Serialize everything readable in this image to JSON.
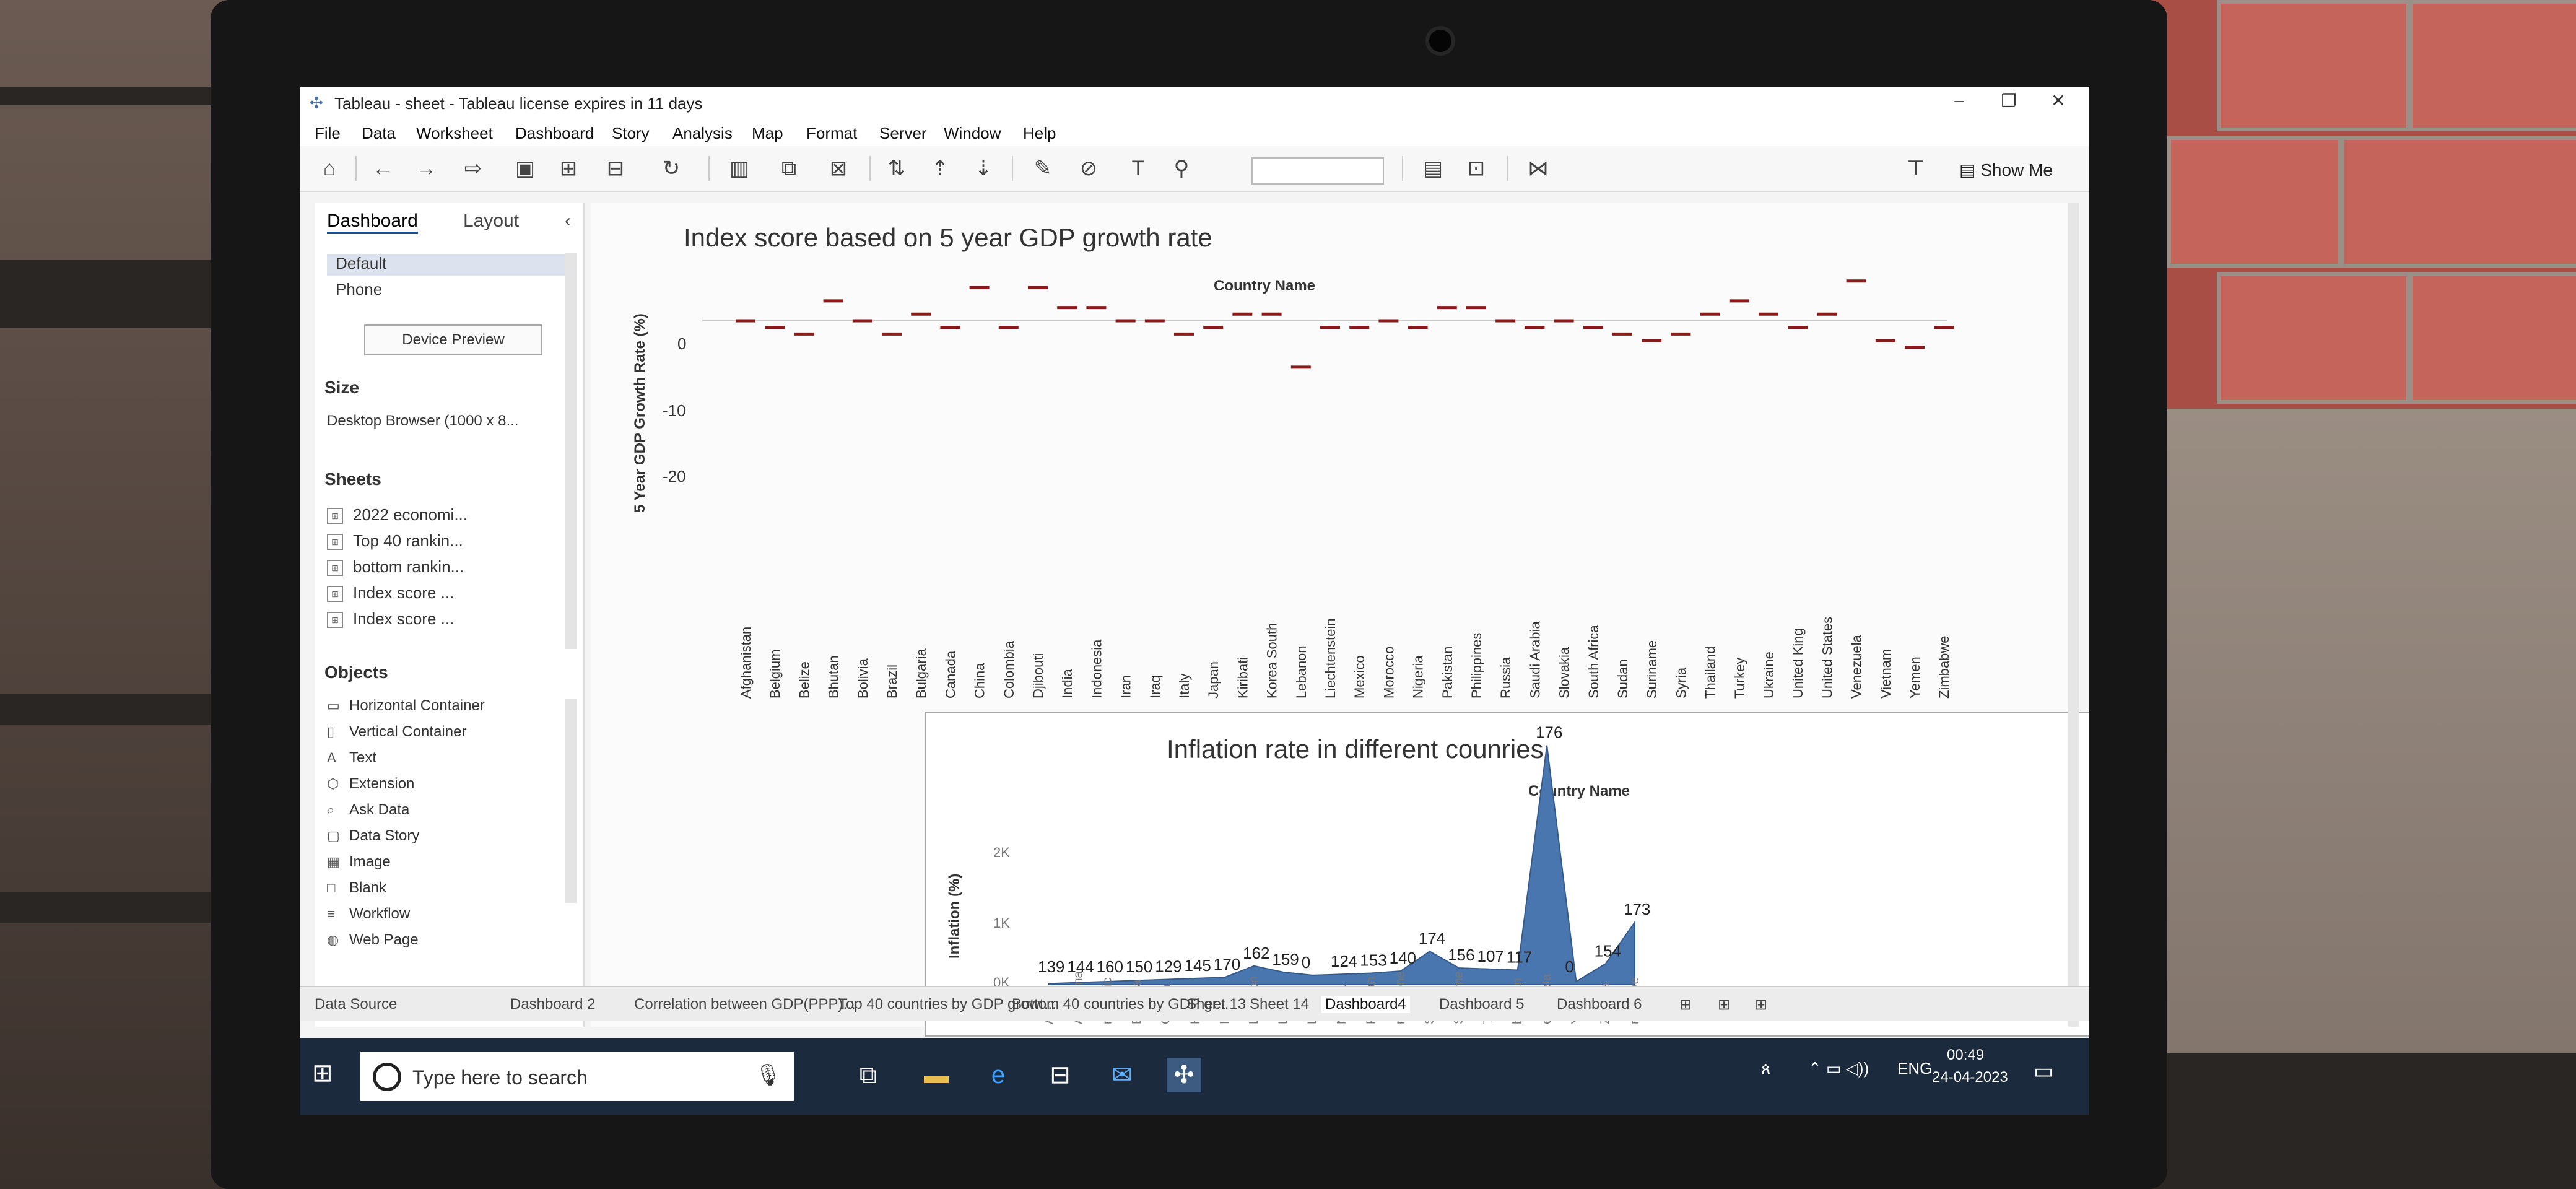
{
  "window": {
    "title": "Tableau - sheet - Tableau license expires in 11 days"
  },
  "menu": [
    "File",
    "Data",
    "Worksheet",
    "Dashboard",
    "Story",
    "Analysis",
    "Map",
    "Format",
    "Server",
    "Window",
    "Help"
  ],
  "toolbar": {
    "show_me": "Show Me"
  },
  "left_pane": {
    "tabs": [
      "Dashboard",
      "Layout"
    ],
    "devices": [
      "Default",
      "Phone"
    ],
    "device_preview": "Device Preview",
    "size_heading": "Size",
    "size_value": "Desktop Browser (1000 x 8...",
    "sheets_heading": "Sheets",
    "sheets": [
      "2022 economi...",
      "Top 40 rankin...",
      "bottom rankin...",
      "Index score ...",
      "Index score ..."
    ],
    "objects_heading": "Objects",
    "objects": [
      {
        "label": "Horizontal Container",
        "icon": "horizontal-container-icon"
      },
      {
        "label": "Vertical Container",
        "icon": "vertical-container-icon"
      },
      {
        "label": "Text",
        "icon": "text-icon"
      },
      {
        "label": "Extension",
        "icon": "extension-icon"
      },
      {
        "label": "Ask Data",
        "icon": "ask-data-icon"
      },
      {
        "label": "Data Story",
        "icon": "data-story-icon"
      },
      {
        "label": "Image",
        "icon": "image-icon"
      },
      {
        "label": "Blank",
        "icon": "blank-icon"
      },
      {
        "label": "Workflow",
        "icon": "workflow-icon"
      },
      {
        "label": "Web Page",
        "icon": "web-page-icon"
      }
    ]
  },
  "chart_data": [
    {
      "type": "scatter",
      "title": "Index score based on 5 year GDP growth rate",
      "column_header": "Country Name",
      "ylabel": "5 Year GDP Growth Rate (%)",
      "yticks": [
        "0",
        "-10",
        "-20"
      ],
      "ylim": [
        -22,
        8
      ],
      "categories": [
        "Afghanistan",
        "Belgium",
        "Belize",
        "Bhutan",
        "Bolivia",
        "Brazil",
        "Bulgaria",
        "Canada",
        "China",
        "Colombia",
        "Djibouti",
        "India",
        "Indonesia",
        "Iran",
        "Iraq",
        "Italy",
        "Japan",
        "Kiribati",
        "Korea South",
        "Lebanon",
        "Liechtenstein",
        "Mexico",
        "Morocco",
        "Nigeria",
        "Pakistan",
        "Philippines",
        "Russia",
        "Saudi Arabia",
        "Slovakia",
        "South Africa",
        "Sudan",
        "Suriname",
        "Syria",
        "Thailand",
        "Turkey",
        "Ukraine",
        "United King",
        "United States",
        "Venezuela",
        "Vietnam",
        "Yemen",
        "Zimbabwe"
      ],
      "values": [
        0,
        -1,
        -2,
        3,
        0,
        -2,
        1,
        -1,
        5,
        -1,
        5,
        2,
        2,
        0,
        0,
        -2,
        -1,
        1,
        1,
        -7,
        -1,
        -1,
        0,
        -1,
        2,
        2,
        0,
        -1,
        0,
        -1,
        -2,
        -3,
        -2,
        1,
        3,
        1,
        -1,
        1,
        6,
        -3,
        -4,
        -1
      ],
      "color": "#8b1a1a"
    },
    {
      "type": "area",
      "title": "Inflation rate in different counries",
      "column_header": "Country Name",
      "ylabel": "Inflation (%)",
      "yticks": [
        "0K",
        "1K",
        "2K"
      ],
      "ylim": [
        0,
        2500
      ],
      "categories": [
        "Angola",
        "Argentina",
        "Democratic Republic of the Congo",
        "Ethiopia",
        "Guinea",
        "Haiti",
        "Iran",
        "Lebanon",
        "Liberia",
        "Libya",
        "Nigeria",
        "Pakistan",
        "Sierra Leone",
        "Sudan",
        "Suriname",
        "Turkey",
        "Uzbekistan",
        "Venezuela",
        "Yemen",
        "Zambia",
        "Zimbabwe"
      ],
      "category_labels": [
        "Angola",
        "Argentina",
        "mocratic\nhe Congo",
        "Ethiopia",
        "Guinea",
        "Haiti",
        "Iran",
        "Lebanon",
        "Liberia",
        "Libya",
        "Nigeria",
        "Pakistan",
        "rra Leone",
        "Sudan",
        "Suriname",
        "Turkey",
        "bekistan",
        "enezuela",
        "Yemen",
        "Zambia",
        "mbabwe"
      ],
      "values": [
        10,
        20,
        30,
        40,
        50,
        60,
        70,
        180,
        120,
        90,
        100,
        110,
        130,
        320,
        160,
        150,
        140,
        2300,
        30,
        200,
        600
      ],
      "data_labels": [
        "139",
        "144",
        "160",
        "150",
        "129",
        "145",
        "170",
        "162",
        "159",
        "0",
        "124",
        "153",
        "140",
        "174",
        "156",
        "107",
        "117",
        "176",
        "0",
        "154",
        "173"
      ],
      "color": "#4a76b0"
    }
  ],
  "bottom_tabs": [
    "Data Source",
    "Dashboard 2",
    "Correlation between GDP(PPP)...",
    "Top 40 countries by GDP growt...",
    "Bottom 40 countries by GDP gr...",
    "Sheet 13",
    "Sheet 14",
    "Dashboard4",
    "Dashboard 5",
    "Dashboard 6"
  ],
  "active_tab": "Dashboard4",
  "taskbar": {
    "search_placeholder": "Type here to search",
    "lang": "ENG",
    "time": "00:49",
    "date": "24-04-2023"
  }
}
